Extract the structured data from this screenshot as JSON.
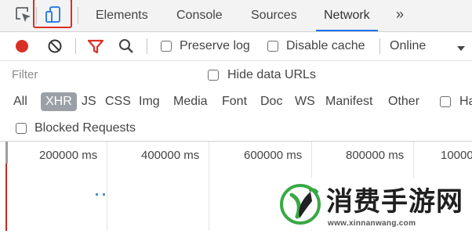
{
  "tabs": [
    {
      "label": "Elements",
      "active": false
    },
    {
      "label": "Console",
      "active": false
    },
    {
      "label": "Sources",
      "active": false
    },
    {
      "label": "Network",
      "active": true
    }
  ],
  "more_tabs_glyph": "»",
  "icons": {
    "inspect": "inspect-element-icon",
    "device": "device-toolbar-icon",
    "record": "record-icon",
    "clear": "clear-icon",
    "filter": "filter-funnel-icon",
    "search": "search-icon",
    "dropdown": "dropdown-arrow-icon"
  },
  "toolbar": {
    "preserve_log_label": "Preserve log",
    "preserve_log_checked": false,
    "disable_cache_label": "Disable cache",
    "disable_cache_checked": false,
    "throttling_value": "Online"
  },
  "filter": {
    "placeholder": "Filter",
    "value": "",
    "hide_data_urls_label": "Hide data URLs",
    "hide_data_urls_checked": false
  },
  "type_filters": [
    {
      "label": "All",
      "active": false
    },
    {
      "label": "XHR",
      "active": true
    },
    {
      "label": "JS",
      "active": false
    },
    {
      "label": "CSS",
      "active": false
    },
    {
      "label": "Img",
      "active": false
    },
    {
      "label": "Media",
      "active": false
    },
    {
      "label": "Font",
      "active": false
    },
    {
      "label": "Doc",
      "active": false
    },
    {
      "label": "WS",
      "active": false
    },
    {
      "label": "Manifest",
      "active": false
    },
    {
      "label": "Other",
      "active": false
    }
  ],
  "has_blocked_cookies_partial": "Ha",
  "blocked_requests_label": "Blocked Requests",
  "timeline_ticks": [
    "200000 ms",
    "400000 ms",
    "600000 ms",
    "800000 ms",
    "10000"
  ],
  "watermark": {
    "site_name": "消费手游网",
    "url": "www.xinnanwang.com"
  },
  "colors": {
    "record_red": "#d93025",
    "filter_red": "#d93025",
    "active_tab_underline": "#1a73e8",
    "active_chip": "#9aa0a6",
    "highlight_box": "#d93025",
    "logo_green": "#3aa845"
  }
}
